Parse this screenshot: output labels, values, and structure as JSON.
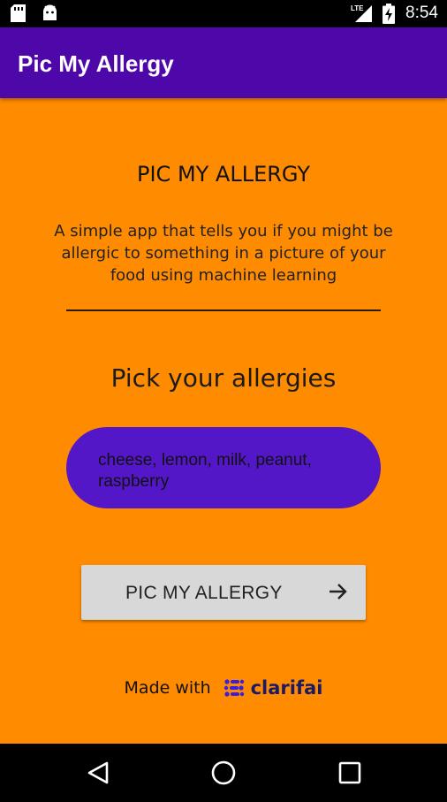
{
  "status_bar": {
    "time": "8:54",
    "network_label": "LTE",
    "icons": [
      "sd-card-icon",
      "android-icon",
      "lte-signal-icon",
      "battery-charging-icon"
    ]
  },
  "app_bar": {
    "title": "Pic My Allergy"
  },
  "main": {
    "heading": "PIC MY ALLERGY",
    "description": "A simple app that tells you if you might be allergic to something in a picture of your food using machine learning",
    "subheading": "Pick your allergies",
    "allergies_value": "cheese, lemon, milk, peanut, raspberry",
    "action_button_label": "PIC MY ALLERGY",
    "made_with_label": "Made with",
    "brand_name": "clarifai"
  },
  "nav_bar": {
    "buttons": [
      "back-icon",
      "home-icon",
      "recents-icon"
    ]
  },
  "colors": {
    "background": "#ff8b00",
    "app_bar": "#4e08aa",
    "allergy_field": "#5417c8",
    "button": "#d8d8d8",
    "brand": "#1a1a66",
    "brand_accent": "#3b1ee0"
  }
}
